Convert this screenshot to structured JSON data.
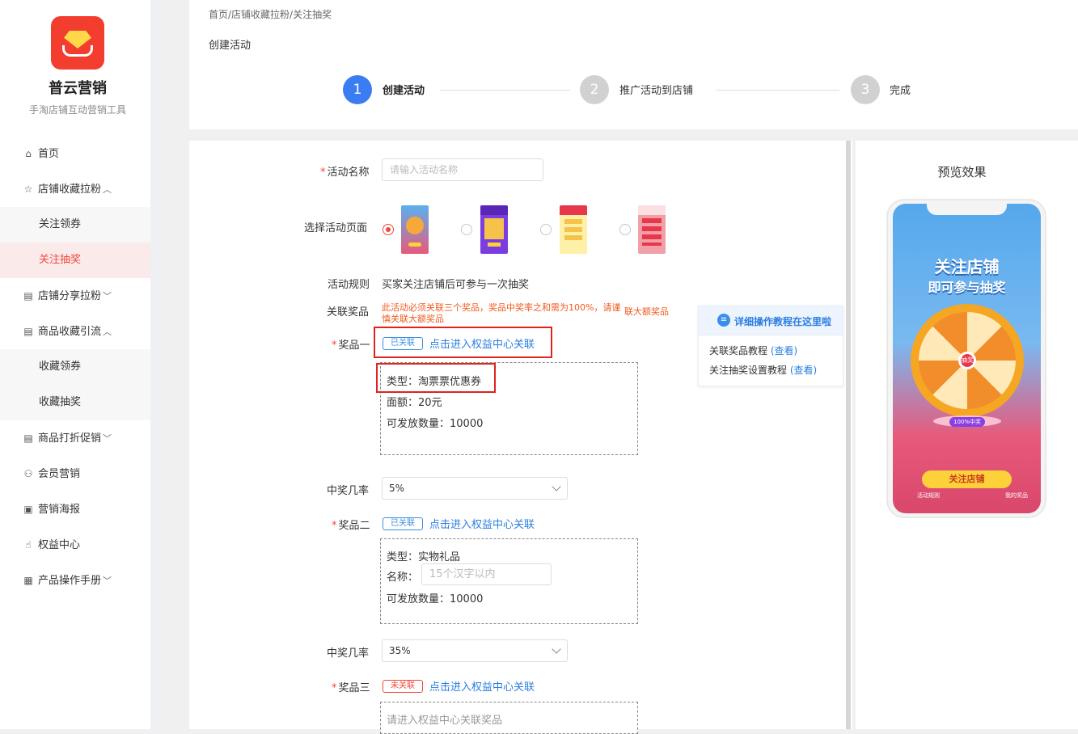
{
  "brand": {
    "name": "普云营销",
    "tagline": "手淘店铺互动营销工具"
  },
  "sidebar": {
    "items": [
      {
        "label": "首页",
        "icon": "home-icon"
      },
      {
        "label": "店铺收藏拉粉",
        "icon": "star-icon",
        "chevron": "︿"
      },
      {
        "label": "关注领券",
        "sub": true
      },
      {
        "label": "关注抽奖",
        "sub": true,
        "active": true
      },
      {
        "label": "店铺分享拉粉",
        "icon": "shop-icon",
        "chevron": "﹀"
      },
      {
        "label": "商品收藏引流",
        "icon": "shop-icon",
        "chevron": "︿"
      },
      {
        "label": "收藏领券",
        "sub": true
      },
      {
        "label": "收藏抽奖",
        "sub": true
      },
      {
        "label": "商品打折促销",
        "icon": "shop-icon",
        "chevron": "﹀"
      },
      {
        "label": "会员营销",
        "icon": "users-icon"
      },
      {
        "label": "营销海报",
        "icon": "image-icon"
      },
      {
        "label": "权益中心",
        "icon": "thumbs-up-icon"
      },
      {
        "label": "产品操作手册",
        "icon": "document-icon",
        "chevron": "﹀"
      }
    ]
  },
  "header": {
    "breadcrumb": "首页/店铺收藏拉粉/关注抽奖",
    "title": "创建活动",
    "steps": [
      {
        "num": "1",
        "label": "创建活动",
        "active": true
      },
      {
        "num": "2",
        "label": "推广活动到店铺",
        "active": false
      },
      {
        "num": "3",
        "label": "完成",
        "active": false
      }
    ]
  },
  "form": {
    "name_label": "活动名称",
    "name_placeholder": "请输入活动名称",
    "page_label": "选择活动页面",
    "rules_label": "活动规则",
    "rules_text": "买家关注店铺后可参与一次抽奖",
    "prizes_label": "关联奖品",
    "prizes_notice": "此活动必须关联三个奖品，奖品中奖率之和需为100%，请谨慎关联大额奖品",
    "prizes_notice2": "联大额奖品",
    "prize1": {
      "label": "奖品一",
      "tag": "已关联",
      "link": "点击进入权益中心关联",
      "type": "类型：淘票票优惠券",
      "value": "面额：20元",
      "quantity": "可发放数量：10000",
      "rate_label": "中奖几率",
      "rate": "5%"
    },
    "prize2": {
      "label": "奖品二",
      "tag": "已关联",
      "link": "点击进入权益中心关联",
      "type": "类型：实物礼品",
      "name_label": "名称：",
      "name_placeholder": "15个汉字以内",
      "quantity": "可发放数量：10000",
      "rate_label": "中奖几率",
      "rate": "35%"
    },
    "prize3": {
      "label": "奖品三",
      "tag": "未关联",
      "link": "点击进入权益中心关联",
      "placeholder": "请进入权益中心关联奖品"
    }
  },
  "help": {
    "title": "详细操作教程在这里啦",
    "line1": "关联奖品教程",
    "line2": "关注抽奖设置教程",
    "view": "(查看)"
  },
  "preview": {
    "title": "预览效果",
    "banner1": "关注店铺",
    "banner2": "即可参与抽奖",
    "hub": "抽奖",
    "badge": "100%中奖",
    "button": "关注店铺",
    "foot_left": "活动规则",
    "foot_right": "我的奖品"
  },
  "colors": {
    "accent": "#f2483a",
    "step_active": "#3a7cf2",
    "link": "#2a7ee0"
  }
}
